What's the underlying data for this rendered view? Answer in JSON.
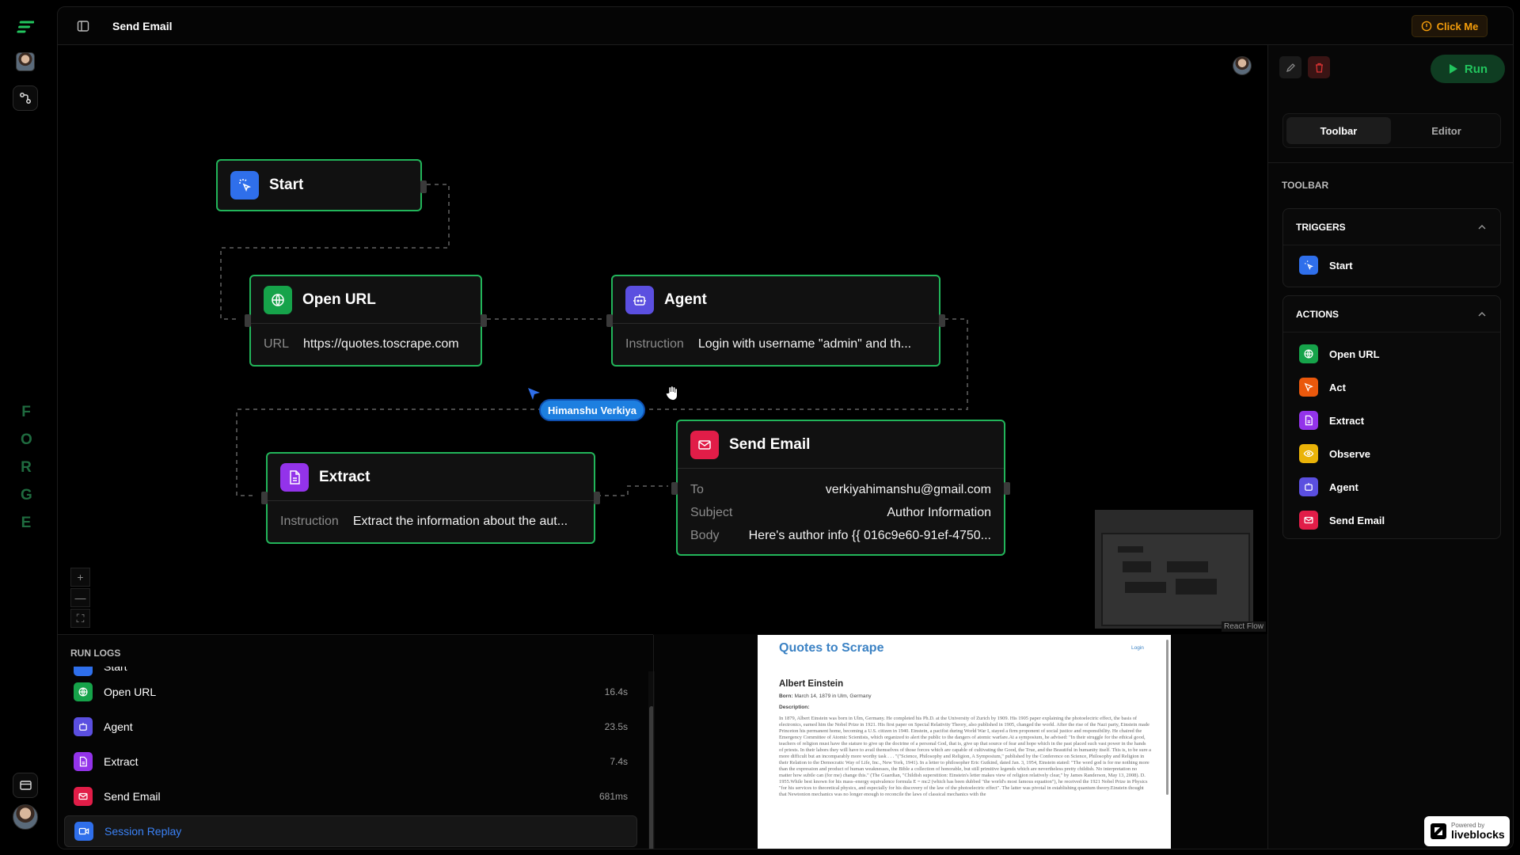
{
  "app": {
    "brand": "FORGE",
    "brand_letters": [
      "F",
      "O",
      "R",
      "G",
      "E"
    ]
  },
  "topbar": {
    "title": "Send Email",
    "cta": "Click Me"
  },
  "nodes": {
    "start": {
      "title": "Start"
    },
    "open_url": {
      "title": "Open URL",
      "field": "URL",
      "value": "https://quotes.toscrape.com"
    },
    "agent": {
      "title": "Agent",
      "field": "Instruction",
      "value": "Login with username \"admin\" and th..."
    },
    "extract": {
      "title": "Extract",
      "field": "Instruction",
      "value": "Extract the information about the aut..."
    },
    "send_email": {
      "title": "Send Email",
      "to_label": "To",
      "to": "verkiyahimanshu@gmail.com",
      "subject_label": "Subject",
      "subject": "Author Information",
      "body_label": "Body",
      "body": "Here's author info {{ 016c9e60-91ef-4750..."
    }
  },
  "cursor": {
    "user": "Himanshu Verkiya"
  },
  "canvas": {
    "attribution": "React Flow",
    "zoom_in": "+",
    "zoom_out": "—",
    "fit": "⛶"
  },
  "right_panel": {
    "run_label": "Run",
    "tabs": [
      "Toolbar",
      "Editor"
    ],
    "active_tab": "Toolbar",
    "section_title": "TOOLBAR",
    "triggers": {
      "title": "TRIGGERS",
      "items": [
        {
          "label": "Start",
          "icon": "pointer-click-icon",
          "color": "#2f6feb"
        }
      ]
    },
    "actions": {
      "title": "ACTIONS",
      "items": [
        {
          "label": "Open URL",
          "icon": "globe-icon",
          "color": "#16a34a"
        },
        {
          "label": "Act",
          "icon": "cursor-icon",
          "color": "#ea580c"
        },
        {
          "label": "Extract",
          "icon": "document-icon",
          "color": "#9333ea"
        },
        {
          "label": "Observe",
          "icon": "eye-icon",
          "color": "#eab308"
        },
        {
          "label": "Agent",
          "icon": "robot-icon",
          "color": "#5b4fe0"
        },
        {
          "label": "Send Email",
          "icon": "mail-icon",
          "color": "#e11d48"
        }
      ]
    }
  },
  "run_logs": {
    "title": "RUN LOGS",
    "partial_item": "Start",
    "items": [
      {
        "label": "Open URL",
        "time": "16.4s",
        "icon": "globe-icon",
        "color": "#16a34a"
      },
      {
        "label": "Agent",
        "time": "23.5s",
        "icon": "robot-icon",
        "color": "#5b4fe0"
      },
      {
        "label": "Extract",
        "time": "7.4s",
        "icon": "document-icon",
        "color": "#9333ea"
      },
      {
        "label": "Send Email",
        "time": "681ms",
        "icon": "mail-icon",
        "color": "#e11d48"
      },
      {
        "label": "Session Replay",
        "time": "",
        "icon": "video-icon",
        "color": "#2f6feb"
      }
    ]
  },
  "preview": {
    "site_title": "Quotes to Scrape",
    "login": "Login",
    "author": "Albert Einstein",
    "born_label": "Born:",
    "born": "March 14, 1879 in Ulm, Germany",
    "description_label": "Description:",
    "description": "In 1879, Albert Einstein was born in Ulm, Germany. He completed his Ph.D. at the University of Zurich by 1909. His 1905 paper explaining the photoelectric effect, the basis of electronics, earned him the Nobel Prize in 1921. His first paper on Special Relativity Theory, also published in 1905, changed the world. After the rise of the Nazi party, Einstein made Princeton his permanent home, becoming a U.S. citizen in 1940. Einstein, a pacifist during World War I, stayed a firm proponent of social justice and responsibility. He chaired the Emergency Committee of Atomic Scientists, which organized to alert the public to the dangers of atomic warfare.At a symposium, he advised: \"In their struggle for the ethical good, teachers of religion must have the stature to give up the doctrine of a personal God, that is, give up that source of fear and hope which in the past placed such vast power in the hands of priests. In their labors they will have to avail themselves of those forces which are capable of cultivating the Good, the True, and the Beautiful in humanity itself. This is, to be sure a more difficult but an incomparably more worthy task . . . \"(\"Science, Philosophy and Religion, A Symposium,\" published by the Conference on Science, Philosophy and Religion in their Relation to the Democratic Way of Life, Inc., New York, 1941). In a letter to philosopher Eric Gutkind, dated Jan. 3, 1954, Einstein stated: \"The word god is for me nothing more than the expression and product of human weaknesses, the Bible a collection of honorable, but still primitive legends which are nevertheless pretty childish. No interpretation no matter how subtle can (for me) change this.\" (The Guardian, \"Childish superstition: Einstein's letter makes view of religion relatively clear,\" by James Randerson, May 13, 2008). D. 1955.While best known for his mass–energy equivalence formula E = mc2 (which has been dubbed \"the world's most famous equation\"), he received the 1921 Nobel Prize in Physics \"for his services to theoretical physics, and especially for his discovery of the law of the photoelectric effect\". The latter was pivotal in establishing quantum theory.Einstein thought that Newtonion mechanics was no longer enough to reconcile the laws of classical mechanics with the"
  },
  "badge": {
    "line1": "Powered by",
    "line2": "liveblocks"
  }
}
